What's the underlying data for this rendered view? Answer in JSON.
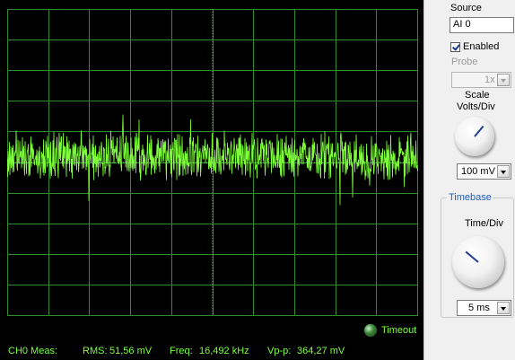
{
  "scope": {
    "timeout_label": "Timeout",
    "signal_color": "#7dff3a",
    "grid_color": "#2e8b2e"
  },
  "measurements": {
    "channel_label": "CH0 Meas:",
    "rms_label": "RMS:",
    "rms_value": "51,56 mV",
    "freq_label": "Freq:",
    "freq_value": "16,492 kHz",
    "vpp_label": "Vp-p:",
    "vpp_value": "364,27 mV"
  },
  "panel": {
    "source_label": "Source",
    "source_value": "AI 0",
    "enabled_label": "Enabled",
    "enabled_checked": true,
    "probe_label": "Probe",
    "probe_value": "1x",
    "scale_label": "Scale",
    "volts_div_label": "Volts/Div",
    "volts_div_value": "100 mV",
    "timebase_label": "Timebase",
    "time_div_label": "Time/Div",
    "time_div_value": "5 ms"
  }
}
